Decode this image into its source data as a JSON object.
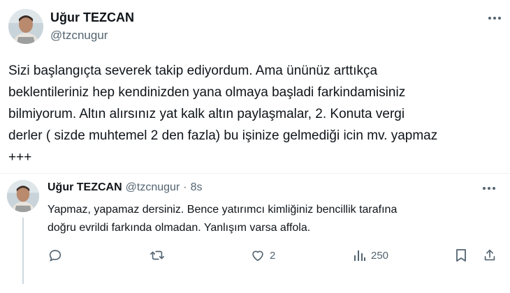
{
  "main_tweet": {
    "author_name": "Uğur TEZCAN",
    "author_handle": "@tzcnugur",
    "more_icon": "more-horizontal-icon",
    "text": "Sizi başlangıçta severek takip ediyordum. Ama ününüz arttıkça\nbeklentileriniz hep kendinizden yana olmaya başladi farkindamisiniz\nbilmiyorum. Altın alırsınız yat kalk altın paylaşmalar, 2. Konuta vergi\nderler ( sizde muhtemel 2 den fazla) bu işinize gelmediği icin mv. yapmaz\n+++"
  },
  "reply": {
    "author_name": "Uğur TEZCAN",
    "author_handle": "@tzcnugur",
    "separator": "·",
    "time": "8s",
    "more_icon": "more-horizontal-icon",
    "text": "Yapmaz, yapamaz dersiniz. Bence yatırımcı kimliğiniz bencillik tarafına\ndoğru evrildi farkında olmadan. Yanlışım varsa affola.",
    "actions": {
      "reply_icon": "reply-icon",
      "retweet_icon": "retweet-icon",
      "like_icon": "heart-icon",
      "like_count": "2",
      "views_icon": "analytics-icon",
      "views_count": "250",
      "bookmark_icon": "bookmark-icon",
      "share_icon": "share-icon"
    }
  },
  "colors": {
    "text": "#0f1419",
    "secondary": "#536471",
    "divider": "#eff3f4",
    "thread_line": "#cfd9de"
  }
}
